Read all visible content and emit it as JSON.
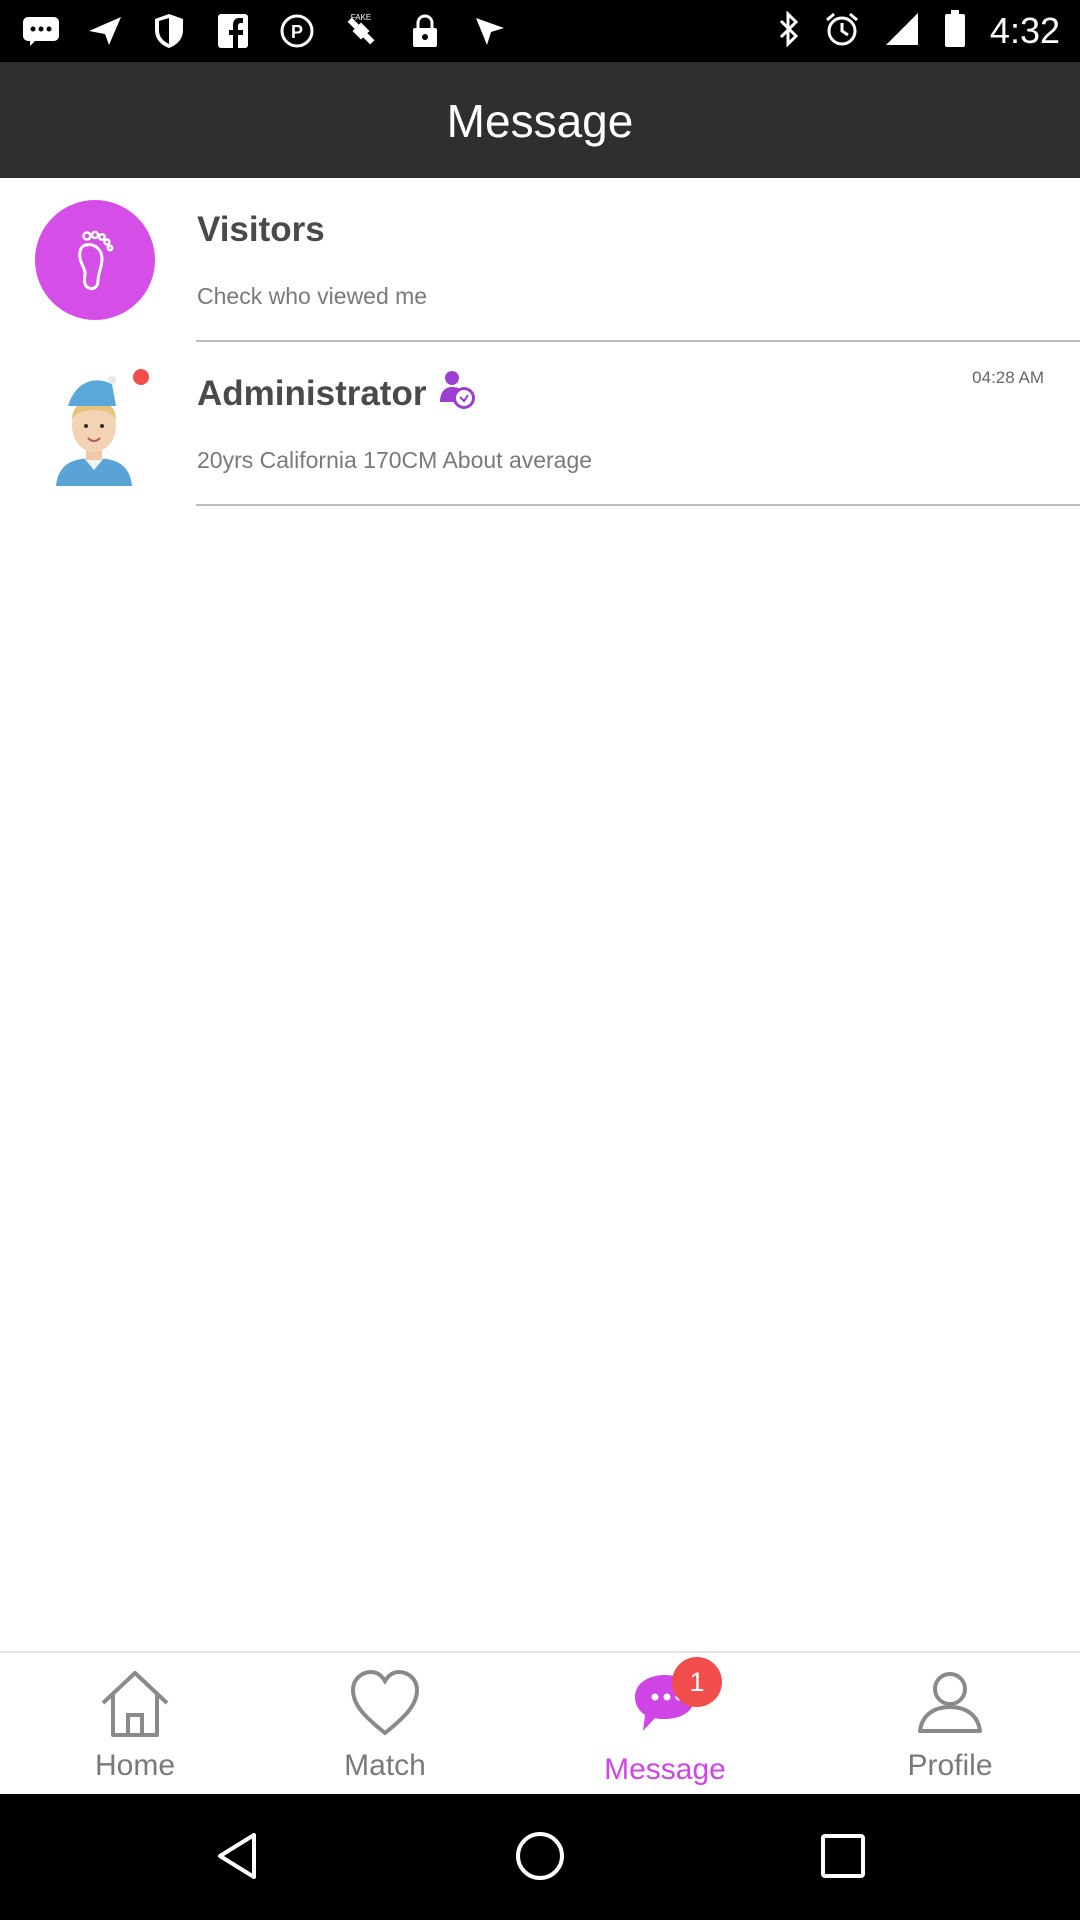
{
  "status_bar": {
    "left_icons": [
      "chat-icon",
      "send-icon",
      "shield-icon",
      "facebook-icon",
      "circle-p-icon",
      "fake-gps-icon",
      "lock-icon",
      "navigation-icon"
    ],
    "right_icons": [
      "bluetooth-icon",
      "alarm-icon",
      "signal-icon",
      "battery-icon"
    ],
    "time": "4:32"
  },
  "header": {
    "title": "Message"
  },
  "list": [
    {
      "title": "Visitors",
      "subtitle": "Check who viewed me",
      "icon": "footprint-icon"
    },
    {
      "title": "Administrator",
      "subtitle": "20yrs California 170CM About average",
      "time": "04:28 AM",
      "unread": true,
      "verified_icon": "verified-user-icon"
    }
  ],
  "tabs": [
    {
      "label": "Home",
      "icon": "home-icon",
      "active": false
    },
    {
      "label": "Match",
      "icon": "heart-icon",
      "active": false
    },
    {
      "label": "Message",
      "icon": "chat-bubble-icon",
      "active": true,
      "badge": "1"
    },
    {
      "label": "Profile",
      "icon": "person-icon",
      "active": false
    }
  ],
  "colors": {
    "accent": "#cf45e6",
    "header_bg": "#2f2f2f",
    "badge": "#f24d4d"
  }
}
